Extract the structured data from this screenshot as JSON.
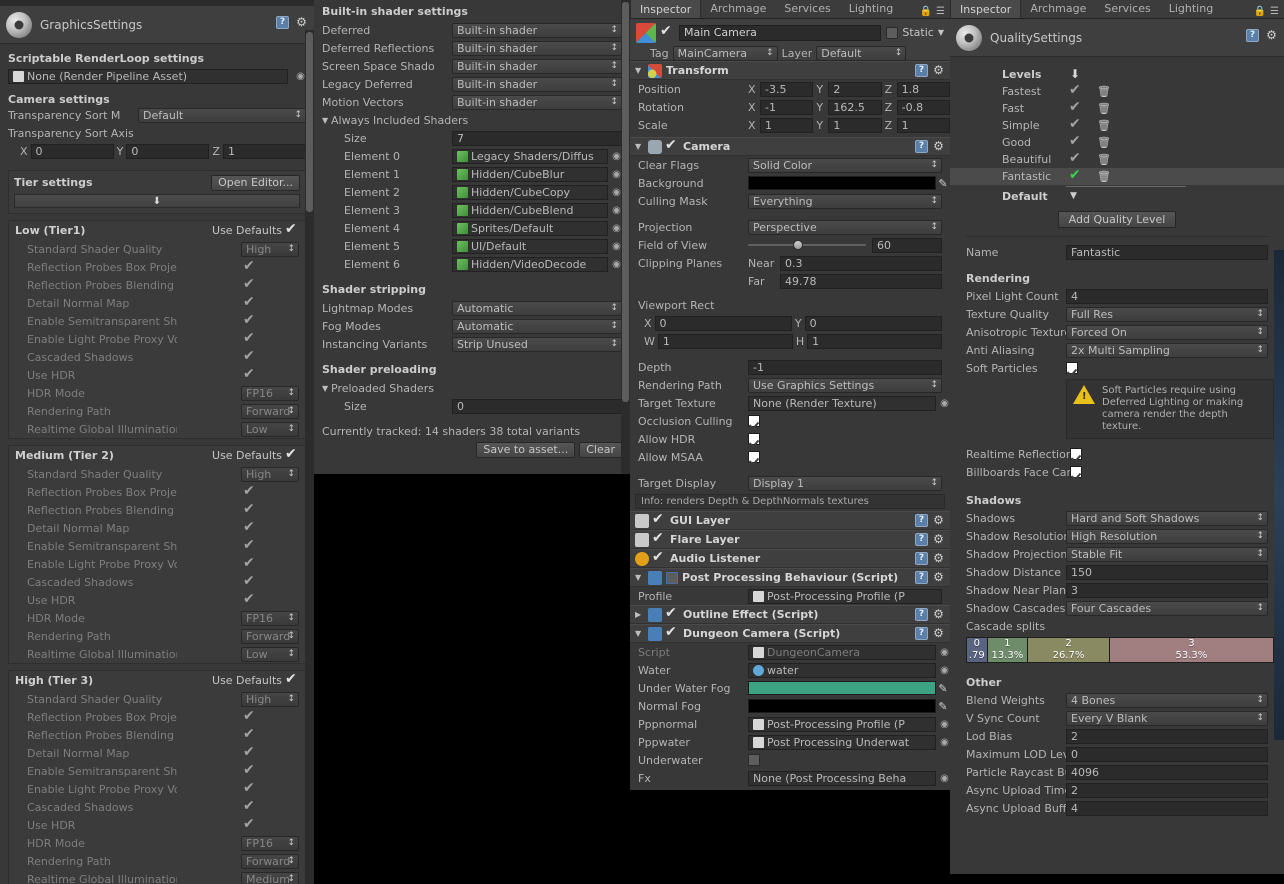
{
  "graphics": {
    "window_title": "GraphicsSettings",
    "sections": {
      "srp_title": "Scriptable RenderLoop settings",
      "srp_value": "None (Render Pipeline Asset)",
      "camera_title": "Camera settings",
      "transparency_sort_mode_label": "Transparency Sort M",
      "transparency_sort_mode_value": "Default",
      "transparency_sort_axis_label": "Transparency Sort Axis",
      "axis": {
        "x_label": "X",
        "x": "0",
        "y_label": "Y",
        "y": "0",
        "z_label": "Z",
        "z": "1"
      },
      "tier_title": "Tier settings",
      "open_editor_label": "Open Editor...",
      "use_defaults_label": "Use Defaults"
    },
    "tiers": [
      {
        "name": "Low (Tier1)",
        "use_defaults": true,
        "props": [
          {
            "label": "Standard Shader Quality",
            "type": "popup",
            "value": "High"
          },
          {
            "label": "Reflection Probes Box Projectio",
            "type": "check",
            "value": true
          },
          {
            "label": "Reflection Probes Blending",
            "type": "check",
            "value": true
          },
          {
            "label": "Detail Normal Map",
            "type": "check",
            "value": true
          },
          {
            "label": "Enable Semitransparent Shado",
            "type": "check",
            "value": true
          },
          {
            "label": "Enable Light Probe Proxy Volur",
            "type": "check",
            "value": true
          },
          {
            "label": "Cascaded Shadows",
            "type": "check",
            "value": true
          },
          {
            "label": "Use HDR",
            "type": "check",
            "value": true
          },
          {
            "label": "HDR Mode",
            "type": "popup",
            "value": "FP16"
          },
          {
            "label": "Rendering Path",
            "type": "popup",
            "value": "Forward"
          },
          {
            "label": "Realtime Global Illumination CI",
            "type": "popup",
            "value": "Low"
          }
        ]
      },
      {
        "name": "Medium (Tier 2)",
        "use_defaults": true,
        "props": [
          {
            "label": "Standard Shader Quality",
            "type": "popup",
            "value": "High"
          },
          {
            "label": "Reflection Probes Box Projectio",
            "type": "check",
            "value": true
          },
          {
            "label": "Reflection Probes Blending",
            "type": "check",
            "value": true
          },
          {
            "label": "Detail Normal Map",
            "type": "check",
            "value": true
          },
          {
            "label": "Enable Semitransparent Shado",
            "type": "check",
            "value": true
          },
          {
            "label": "Enable Light Probe Proxy Volur",
            "type": "check",
            "value": true
          },
          {
            "label": "Cascaded Shadows",
            "type": "check",
            "value": true
          },
          {
            "label": "Use HDR",
            "type": "check",
            "value": true
          },
          {
            "label": "HDR Mode",
            "type": "popup",
            "value": "FP16"
          },
          {
            "label": "Rendering Path",
            "type": "popup",
            "value": "Forward"
          },
          {
            "label": "Realtime Global Illumination CI",
            "type": "popup",
            "value": "Low"
          }
        ]
      },
      {
        "name": "High (Tier 3)",
        "use_defaults": true,
        "props": [
          {
            "label": "Standard Shader Quality",
            "type": "popup",
            "value": "High"
          },
          {
            "label": "Reflection Probes Box Projectio",
            "type": "check",
            "value": true
          },
          {
            "label": "Reflection Probes Blending",
            "type": "check",
            "value": true
          },
          {
            "label": "Detail Normal Map",
            "type": "check",
            "value": true
          },
          {
            "label": "Enable Semitransparent Shado",
            "type": "check",
            "value": true
          },
          {
            "label": "Enable Light Probe Proxy Volur",
            "type": "check",
            "value": true
          },
          {
            "label": "Cascaded Shadows",
            "type": "check",
            "value": true
          },
          {
            "label": "Use HDR",
            "type": "check",
            "value": true
          },
          {
            "label": "HDR Mode",
            "type": "popup",
            "value": "FP16"
          },
          {
            "label": "Rendering Path",
            "type": "popup",
            "value": "Forward"
          },
          {
            "label": "Realtime Global Illumination CI",
            "type": "popup",
            "value": "Medium"
          }
        ]
      }
    ]
  },
  "shader": {
    "builtin_title": "Built-in shader settings",
    "builtin": [
      {
        "label": "Deferred",
        "value": "Built-in shader"
      },
      {
        "label": "Deferred Reflections",
        "value": "Built-in shader"
      },
      {
        "label": "Screen Space Shado",
        "value": "Built-in shader"
      },
      {
        "label": "Legacy Deferred",
        "value": "Built-in shader"
      },
      {
        "label": "Motion Vectors",
        "value": "Built-in shader"
      }
    ],
    "always_included_label": "Always Included Shaders",
    "size_label": "Size",
    "size_value": "7",
    "elements": [
      {
        "label": "Element 0",
        "value": "Legacy Shaders/Diffus"
      },
      {
        "label": "Element 1",
        "value": "Hidden/CubeBlur"
      },
      {
        "label": "Element 2",
        "value": "Hidden/CubeCopy"
      },
      {
        "label": "Element 3",
        "value": "Hidden/CubeBlend"
      },
      {
        "label": "Element 4",
        "value": "Sprites/Default"
      },
      {
        "label": "Element 5",
        "value": "UI/Default"
      },
      {
        "label": "Element 6",
        "value": "Hidden/VideoDecode"
      }
    ],
    "stripping_title": "Shader stripping",
    "stripping": [
      {
        "label": "Lightmap Modes",
        "value": "Automatic"
      },
      {
        "label": "Fog Modes",
        "value": "Automatic"
      },
      {
        "label": "Instancing Variants",
        "value": "Strip Unused"
      }
    ],
    "preloading_title": "Shader preloading",
    "preloaded_label": "Preloaded Shaders",
    "preloaded_size_label": "Size",
    "preloaded_size_value": "0",
    "tracked_text": "Currently tracked: 14 shaders 38 total variants",
    "save_label": "Save to asset...",
    "clear_label": "Clear"
  },
  "inspector": {
    "tabs": [
      {
        "label": "Inspector",
        "active": true
      },
      {
        "label": "Archmage",
        "active": false
      },
      {
        "label": "Services",
        "active": false
      },
      {
        "label": "Lighting",
        "active": false
      }
    ],
    "gameobject": {
      "name": "Main Camera",
      "enabled": true,
      "static_label": "Static",
      "static_checked": false,
      "tag_label": "Tag",
      "tag_value": "MainCamera",
      "layer_label": "Layer",
      "layer_value": "Default"
    },
    "transform": {
      "title": "Transform",
      "position_label": "Position",
      "position": {
        "x": "-3.5",
        "y": "2",
        "z": "1.8"
      },
      "rotation_label": "Rotation",
      "rotation": {
        "x": "-1",
        "y": "162.5",
        "z": "-0.8"
      },
      "scale_label": "Scale",
      "scale": {
        "x": "1",
        "y": "1",
        "z": "1"
      }
    },
    "camera": {
      "title": "Camera",
      "enabled": true,
      "clear_flags_label": "Clear Flags",
      "clear_flags_value": "Solid Color",
      "background_label": "Background",
      "background_color": "#000000",
      "culling_mask_label": "Culling Mask",
      "culling_mask_value": "Everything",
      "projection_label": "Projection",
      "projection_value": "Perspective",
      "fov_label": "Field of View",
      "fov_value": "60",
      "clipping_label": "Clipping Planes",
      "near_label": "Near",
      "near_value": "0.3",
      "far_label": "Far",
      "far_value": "49.78",
      "viewport_label": "Viewport Rect",
      "viewport": {
        "x_label": "X",
        "x": "0",
        "y_label": "Y",
        "y": "0",
        "w_label": "W",
        "w": "1",
        "h_label": "H",
        "h": "1"
      },
      "depth_label": "Depth",
      "depth_value": "-1",
      "rendering_path_label": "Rendering Path",
      "rendering_path_value": "Use Graphics Settings",
      "target_texture_label": "Target Texture",
      "target_texture_value": "None (Render Texture)",
      "occlusion_label": "Occlusion Culling",
      "occlusion_checked": true,
      "hdr_label": "Allow HDR",
      "hdr_checked": true,
      "msaa_label": "Allow MSAA",
      "msaa_checked": true,
      "target_display_label": "Target Display",
      "target_display_value": "Display 1",
      "info_text": "Info: renders Depth & DepthNormals textures"
    },
    "components": [
      {
        "name": "GUI Layer",
        "enabled": true
      },
      {
        "name": "Flare Layer",
        "enabled": true
      },
      {
        "name": "Audio Listener",
        "enabled": true
      }
    ],
    "post_processing": {
      "title": "Post Processing Behaviour (Script)",
      "enabled": false,
      "profile_label": "Profile",
      "profile_value": "Post-Processing Profile (P"
    },
    "outline_effect": {
      "title": "Outline Effect (Script)",
      "enabled": true
    },
    "dungeon_camera": {
      "title": "Dungeon Camera (Script)",
      "enabled": true,
      "props": [
        {
          "label": "Script",
          "type": "object",
          "value": "DungeonCamera",
          "dim": true
        },
        {
          "label": "Water",
          "type": "object",
          "value": "water",
          "dim": false
        },
        {
          "label": "Under Water Fog",
          "type": "color",
          "value": "#3da383"
        },
        {
          "label": "Normal Fog",
          "type": "color",
          "value": "#000000"
        },
        {
          "label": "Pppnormal",
          "type": "object",
          "value": "Post-Processing Profile (P",
          "dim": false
        },
        {
          "label": "Pppwater",
          "type": "object",
          "value": "Post Processing Underwat",
          "dim": false
        },
        {
          "label": "Underwater",
          "type": "check",
          "value": false
        },
        {
          "label": "Fx",
          "type": "object",
          "value": "None (Post Processing Beha",
          "dim": false
        }
      ]
    }
  },
  "quality": {
    "tabs": [
      {
        "label": "Inspector",
        "active": true
      },
      {
        "label": "Archmage",
        "active": false
      },
      {
        "label": "Services",
        "active": false
      },
      {
        "label": "Lighting",
        "active": false
      }
    ],
    "window_title": "QualitySettings",
    "levels_label": "Levels",
    "levels": [
      {
        "name": "Fastest",
        "enabled": true,
        "selected": false
      },
      {
        "name": "Fast",
        "enabled": true,
        "selected": false
      },
      {
        "name": "Simple",
        "enabled": true,
        "selected": false
      },
      {
        "name": "Good",
        "enabled": true,
        "selected": false
      },
      {
        "name": "Beautiful",
        "enabled": true,
        "selected": false
      },
      {
        "name": "Fantastic",
        "enabled": true,
        "selected": true
      }
    ],
    "default_label": "Default",
    "add_level_label": "Add Quality Level",
    "name_label": "Name",
    "name_value": "Fantastic",
    "rendering_title": "Rendering",
    "rendering": [
      {
        "label": "Pixel Light Count",
        "type": "field",
        "value": "4"
      },
      {
        "label": "Texture Quality",
        "type": "popup",
        "value": "Full Res"
      },
      {
        "label": "Anisotropic Textures",
        "type": "popup",
        "value": "Forced On"
      },
      {
        "label": "Anti Aliasing",
        "type": "popup",
        "value": "2x Multi Sampling"
      },
      {
        "label": "Soft Particles",
        "type": "check",
        "value": true
      }
    ],
    "warning_text": "Soft Particles require using Deferred Lighting or making camera render the depth texture.",
    "realtime_reflection_label": "Realtime Reflection F",
    "realtime_reflection_checked": true,
    "billboards_label": "Billboards Face Cam",
    "billboards_checked": true,
    "shadows_title": "Shadows",
    "shadows": [
      {
        "label": "Shadows",
        "type": "popup",
        "value": "Hard and Soft Shadows"
      },
      {
        "label": "Shadow Resolution",
        "type": "popup",
        "value": "High Resolution"
      },
      {
        "label": "Shadow Projection",
        "type": "popup",
        "value": "Stable Fit"
      },
      {
        "label": "Shadow Distance",
        "type": "field",
        "value": "150"
      },
      {
        "label": "Shadow Near Plane (",
        "type": "field",
        "value": "3"
      },
      {
        "label": "Shadow Cascades",
        "type": "popup",
        "value": "Four Cascades"
      }
    ],
    "cascade_splits_label": "Cascade splits",
    "cascades": [
      {
        "index": "0",
        "percent": ".79",
        "width": 6.7,
        "color": "#5a6480"
      },
      {
        "index": "1",
        "percent": "13.3%",
        "width": 13.3,
        "color": "#6e8c6a"
      },
      {
        "index": "2",
        "percent": "26.7%",
        "width": 26.7,
        "color": "#8a8a62"
      },
      {
        "index": "3",
        "percent": "53.3%",
        "width": 53.3,
        "color": "#a17f80"
      }
    ],
    "other_title": "Other",
    "other": [
      {
        "label": "Blend Weights",
        "type": "popup",
        "value": "4 Bones"
      },
      {
        "label": "V Sync Count",
        "type": "popup",
        "value": "Every V Blank"
      },
      {
        "label": "Lod Bias",
        "type": "field",
        "value": "2"
      },
      {
        "label": "Maximum LOD Level",
        "type": "field",
        "value": "0"
      },
      {
        "label": "Particle Raycast Bud",
        "type": "field",
        "value": "4096"
      },
      {
        "label": "Async Upload Time S",
        "type": "field",
        "value": "2"
      },
      {
        "label": "Async Upload Buffer",
        "type": "field",
        "value": "4"
      }
    ]
  }
}
